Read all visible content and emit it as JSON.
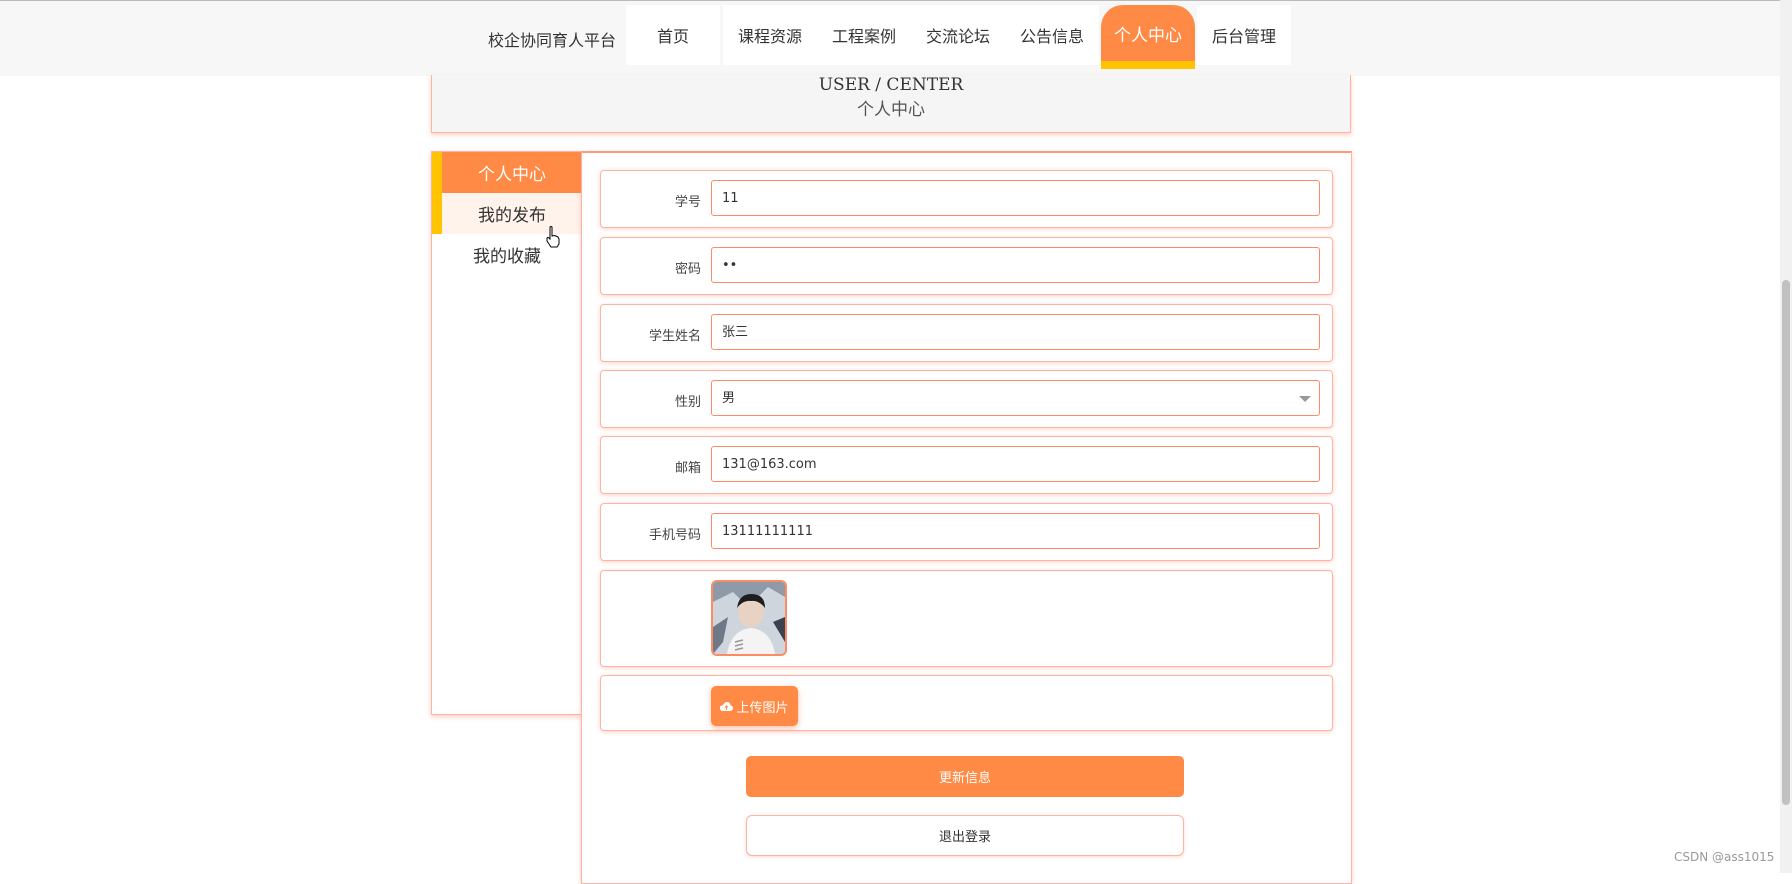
{
  "nav": {
    "brand": "校企协同育人平台",
    "items": [
      {
        "label": "首页"
      },
      {
        "label": "课程资源"
      },
      {
        "label": "工程案例"
      },
      {
        "label": "交流论坛"
      },
      {
        "label": "公告信息"
      },
      {
        "label": "个人中心",
        "active": true
      },
      {
        "label": "后台管理"
      }
    ]
  },
  "banner": {
    "title_en": "USER / CENTER",
    "title_zh": "个人中心"
  },
  "sidebar": {
    "items": [
      {
        "label": "个人中心",
        "state": "active"
      },
      {
        "label": "我的发布",
        "state": "hover"
      },
      {
        "label": "我的收藏",
        "state": "normal"
      }
    ]
  },
  "form": {
    "student_id": {
      "label": "学号",
      "value": "11"
    },
    "password": {
      "label": "密码",
      "value": "••"
    },
    "student_name": {
      "label": "学生姓名",
      "value": "张三"
    },
    "gender": {
      "label": "性别",
      "value": "男"
    },
    "email": {
      "label": "邮箱",
      "value": "131@163.com"
    },
    "phone": {
      "label": "手机号码",
      "value": "13111111111"
    },
    "upload_label": "上传图片"
  },
  "actions": {
    "update_label": "更新信息",
    "logout_label": "退出登录"
  },
  "watermark": "CSDN @ass1015",
  "colors": {
    "accent": "#ff8a45",
    "highlight": "#ffc300",
    "border": "#ffb3a3"
  }
}
